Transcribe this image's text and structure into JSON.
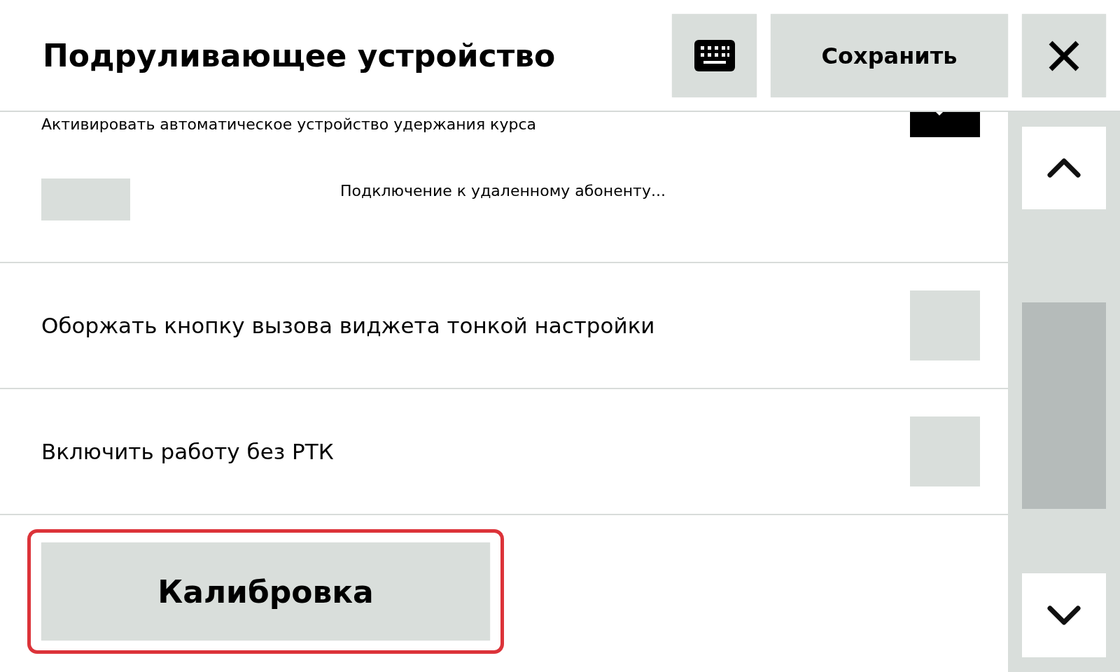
{
  "header": {
    "title": "Подруливающее устройство",
    "toolbar": [
      {
        "kind": "keyboard"
      },
      {
        "kind": "text",
        "label": "Сохранить"
      },
      {
        "kind": "close"
      }
    ]
  },
  "settings": [
    {
      "kind": "compact",
      "label": "Активировать автоматическое устройство удержания курса",
      "checked": true,
      "status": "Подключение к удаленному абоненту..."
    },
    {
      "kind": "checkbox",
      "label": "Оборжать кнопку вызова виджета тонкой настройки",
      "checked": false
    },
    {
      "kind": "checkbox",
      "label": "Включить работу без РТК",
      "checked": false
    }
  ],
  "calibration_button": {
    "label": "Калибровка",
    "highlighted": true
  }
}
